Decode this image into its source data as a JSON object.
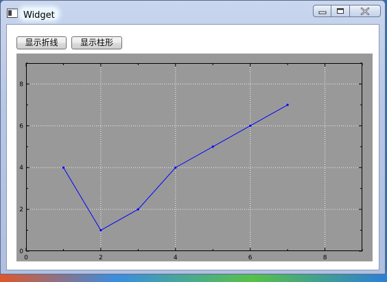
{
  "window": {
    "title": "Widget",
    "controls": [
      "minimize",
      "maximize",
      "close"
    ]
  },
  "toolbar": {
    "show_line_label": "显示折线",
    "show_bar_label": "显示柱形"
  },
  "colors": {
    "plot_background": "#999999",
    "series_line": "#0000ff",
    "grid": "#ffffff",
    "axis": "#000000"
  },
  "chart_data": {
    "type": "line",
    "x": [
      1,
      2,
      3,
      4,
      5,
      6,
      7
    ],
    "series": [
      {
        "values": [
          4,
          1,
          2,
          4,
          5,
          6,
          7
        ]
      }
    ],
    "xlim": [
      0,
      9
    ],
    "ylim": [
      0,
      9
    ],
    "xticks": [
      0,
      2,
      4,
      6,
      8
    ],
    "yticks": [
      0,
      2,
      4,
      6,
      8
    ],
    "grid": true,
    "grid_style": "dotted"
  }
}
